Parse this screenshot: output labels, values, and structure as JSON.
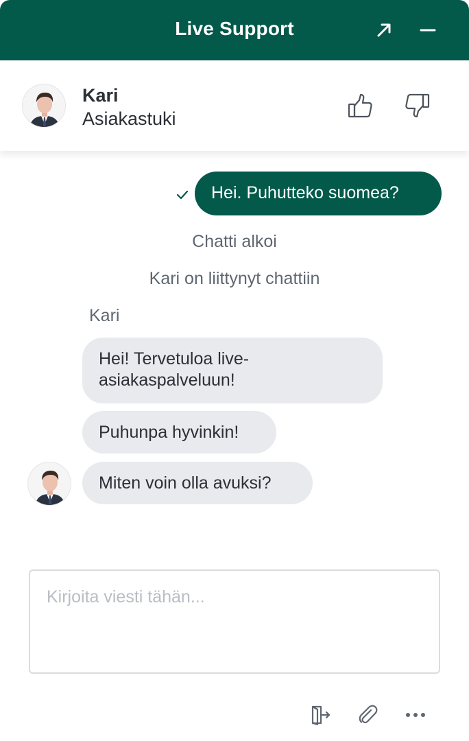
{
  "header": {
    "title": "Live Support",
    "expand_icon": "expand-arrow-icon",
    "minimize_icon": "minimize-icon",
    "bg_color": "#03594a"
  },
  "agent": {
    "name": "Kari",
    "role": "Asiakastuki",
    "avatar_icon": "agent-avatar"
  },
  "rating": {
    "thumbs_up_icon": "thumbs-up-icon",
    "thumbs_down_icon": "thumbs-down-icon"
  },
  "messages": {
    "outgoing": [
      {
        "text": "Hei. Puhutteko suomea?",
        "status_icon": "check-icon"
      }
    ],
    "system": [
      "Chatti alkoi",
      "Kari on liittynyt chattiin"
    ],
    "incoming_sender": "Kari",
    "incoming": [
      "Hei! Tervetuloa live-asiakaspalveluun!",
      "Puhunpa hyvinkin!",
      "Miten voin olla avuksi?"
    ]
  },
  "composer": {
    "placeholder": "Kirjoita viesti tähän...",
    "value": ""
  },
  "toolbar": {
    "exit_icon": "exit-chat-icon",
    "attach_icon": "paperclip-icon",
    "more_icon": "more-options-icon"
  }
}
